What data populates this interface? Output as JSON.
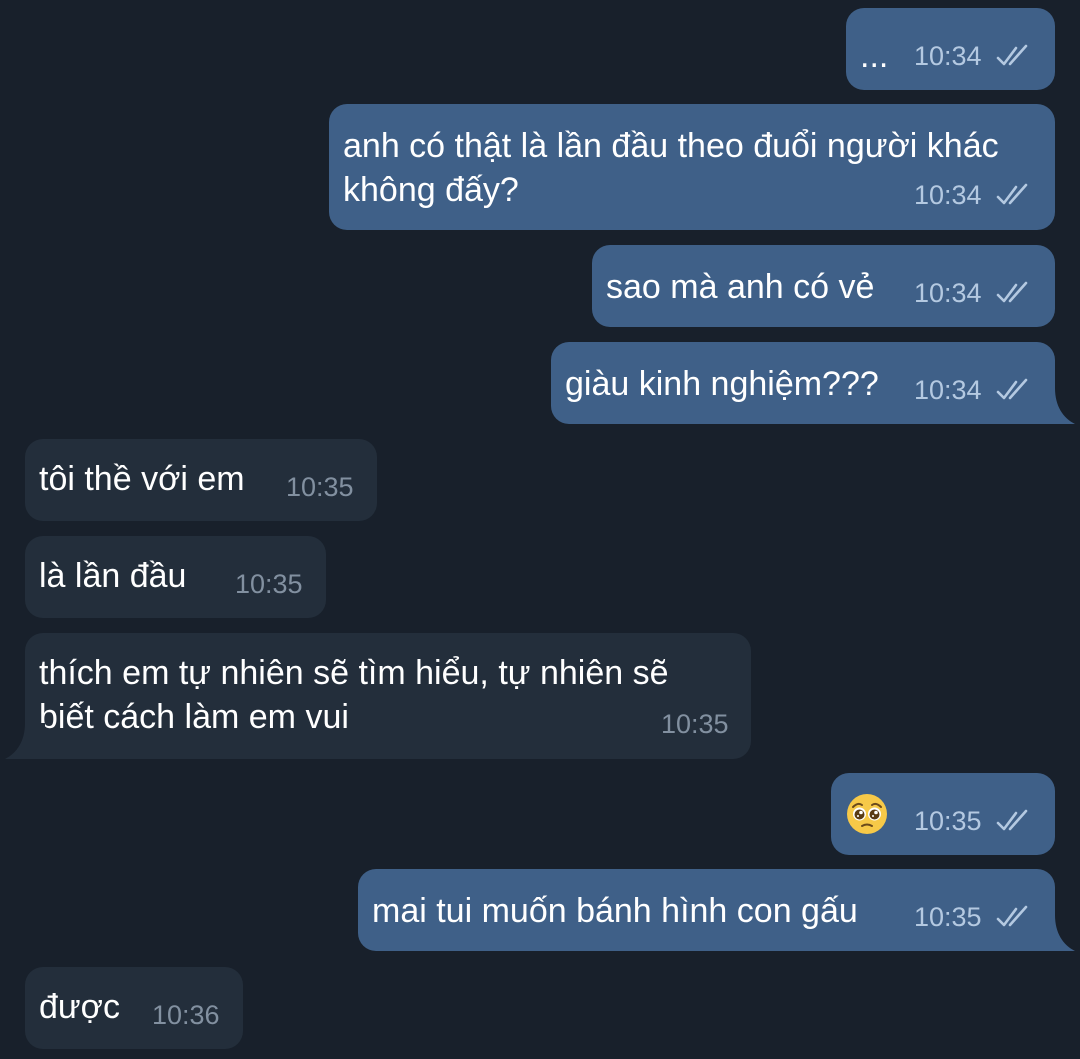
{
  "messages": [
    {
      "direction": "outgoing",
      "text": "...",
      "time": "10:34",
      "status": "read"
    },
    {
      "direction": "outgoing",
      "text_line1": "anh có thật là lần đầu theo đuổi người khác",
      "text_line2": "không đấy?",
      "time": "10:34",
      "status": "read"
    },
    {
      "direction": "outgoing",
      "text": "sao mà anh có vẻ",
      "time": "10:34",
      "status": "read"
    },
    {
      "direction": "outgoing",
      "text": "giàu kinh nghiệm???",
      "time": "10:34",
      "status": "read"
    },
    {
      "direction": "incoming",
      "text": "tôi thề với em",
      "time": "10:35"
    },
    {
      "direction": "incoming",
      "text": "là lần đầu",
      "time": "10:35"
    },
    {
      "direction": "incoming",
      "text_line1": "thích em tự nhiên sẽ tìm hiểu, tự nhiên sẽ",
      "text_line2": "biết cách làm em vui",
      "time": "10:35"
    },
    {
      "direction": "outgoing",
      "emoji": "pleading-face",
      "time": "10:35",
      "status": "read"
    },
    {
      "direction": "outgoing",
      "text": "mai tui muốn bánh hình con gấu",
      "time": "10:35",
      "status": "read"
    },
    {
      "direction": "incoming",
      "text": "được",
      "time": "10:36"
    }
  ],
  "colors": {
    "background": "#18202b",
    "outgoing_bubble": "#3f6088",
    "incoming_bubble": "#232e3b",
    "outgoing_time": "#b4c9e1",
    "incoming_time": "#8290a0",
    "read_ticks": "#b4c9e1"
  }
}
